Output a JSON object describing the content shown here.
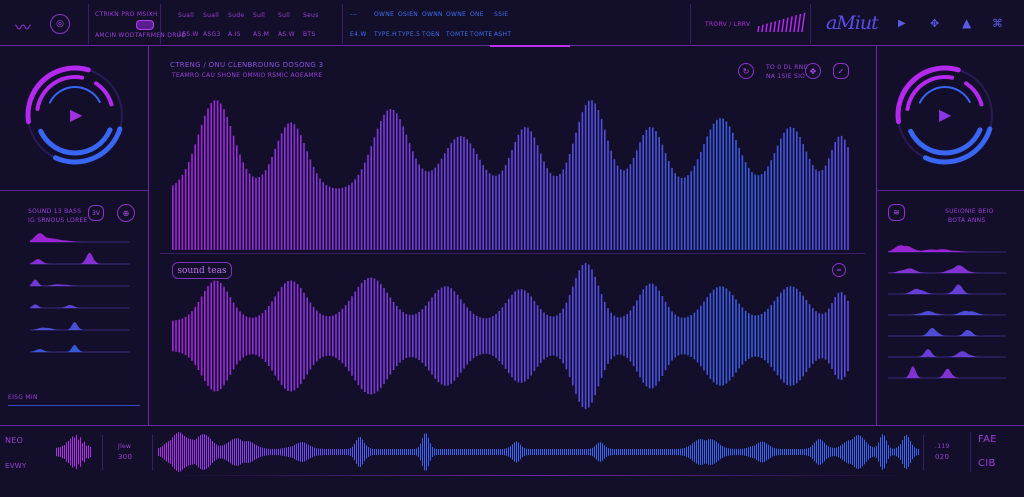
{
  "colors": {
    "background": "#130e29",
    "accent_purple": "#b428f0",
    "accent_blue": "#3a66f5",
    "divider": "#5a2590"
  },
  "topbar": {
    "logo_icon": "waveform-logo-icon",
    "menu_icon": "headphones-icon",
    "title": "CTRIKN PRO MSIXH",
    "subtitle": "AMCIN WODTAFRMEN DRUD",
    "purple_columns": [
      "Suall",
      "Suall",
      "Sude",
      "Sull",
      "Sull",
      "Seus"
    ],
    "purple_values": [
      "1ES.W",
      "ASG3",
      "A.IS",
      "AS.M",
      "AS.W",
      "BTS"
    ],
    "blue_columns": [
      "---",
      "OWNE",
      "OSIEN",
      "OWNN",
      "OWNE",
      "ONE",
      "SSIE"
    ],
    "blue_values": [
      "E4.W",
      "TYPE.H",
      "TYPE.5",
      "TOEN",
      "TOMTE",
      "TOMTE",
      "ASHT"
    ],
    "wave_label": "TRORV / LRRV",
    "brand": "aMiut",
    "icons": [
      "speaker-icon",
      "gamepad-icon",
      "triangle-icon",
      "mixer-icon"
    ]
  },
  "left": {
    "player_icon": "play-icon",
    "track_title": "SOUND 13 BASS",
    "track_sub": "IG SRNOUS LOREE",
    "btn_label": "3V",
    "btn_icon": "globe-icon",
    "footer": "EISG MIN"
  },
  "center": {
    "title": "CTRENG / ONU CLENBRDUNG DOSONG 3",
    "subtitle": "TEAMRO CAU  SHONE OMMIO RSMIC  AOEAMRE",
    "header_icons": [
      "loop-icon",
      "gamepad-icon",
      "shield-icon"
    ],
    "header_text": "TO 0 DL RNC",
    "header_sub": "NA 1SIE  SIO",
    "track_label": "sound teas",
    "track_icon": "link-icon"
  },
  "right": {
    "player_icon": "play-icon",
    "icon": "waveform-icon",
    "title": "SUEIONIE BEIO",
    "sub": "BOTA ANNS"
  },
  "bottom": {
    "left_top": "NEO",
    "left_bottom": "EVWY",
    "mid_label": "Jlew",
    "mid_value": "300",
    "right_label": ".119",
    "right_value": "020",
    "far_top": "FAE",
    "far_bottom": "CIB"
  }
}
